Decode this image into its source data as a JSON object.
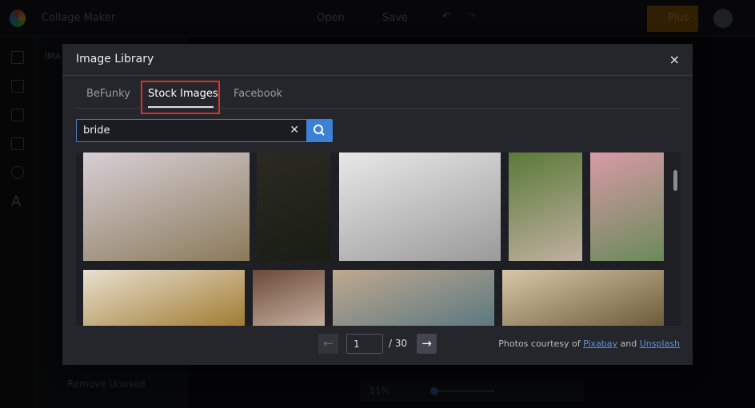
{
  "app": {
    "title": "Collage Maker",
    "open_label": "Open",
    "save_label": "Save",
    "plus_label": "Plus",
    "panel_heading": "IMA",
    "remove_unused": "Remove Unused",
    "zoom": "11%"
  },
  "modal": {
    "title": "Image Library",
    "tabs": [
      {
        "label": "BeFunky"
      },
      {
        "label": "Stock Images",
        "active": true
      },
      {
        "label": "Facebook"
      }
    ],
    "search": {
      "value": "bride"
    },
    "images": [
      {
        "desc": "bride with bouquet on hillside",
        "colors": [
          "#d8cfd6",
          "#8a7a5a"
        ]
      },
      {
        "desc": "bride in dark doorway",
        "colors": [
          "#2a2a22",
          "#1a1d14"
        ]
      },
      {
        "desc": "black and white bride with veil",
        "colors": [
          "#e8e8e8",
          "#9a9a9a"
        ]
      },
      {
        "desc": "bride in green field",
        "colors": [
          "#5a7a38",
          "#c0b0a0"
        ]
      },
      {
        "desc": "bride with pink smoke",
        "colors": [
          "#d89aa6",
          "#6a8a5a"
        ]
      },
      {
        "desc": "bride with white feather fan",
        "colors": [
          "#e8e0d0",
          "#a07a30"
        ]
      },
      {
        "desc": "bride with flower crown",
        "colors": [
          "#6a4a3a",
          "#c8b0a0"
        ]
      },
      {
        "desc": "bride with guests",
        "colors": [
          "#c0a890",
          "#5a7880"
        ]
      },
      {
        "desc": "couple at castle",
        "colors": [
          "#d8c8a8",
          "#6a5a3a"
        ]
      }
    ],
    "pagination": {
      "current": "1",
      "total": "/ 30",
      "prev": "←",
      "next": "→"
    },
    "credits": {
      "prefix": "Photos courtesy of",
      "link1": "Pixabay",
      "and": "and",
      "link2": "Unsplash"
    },
    "close": "×",
    "accent": "#3b82d6"
  }
}
